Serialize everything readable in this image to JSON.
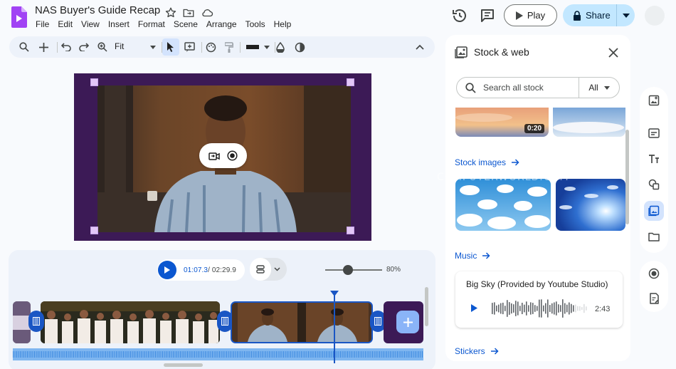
{
  "app": {
    "title": "NAS Buyer's Guide Recap"
  },
  "menu": [
    "File",
    "Edit",
    "View",
    "Insert",
    "Format",
    "Scene",
    "Arrange",
    "Tools",
    "Help"
  ],
  "header": {
    "play_label": "Play",
    "share_label": "Share"
  },
  "toolbar": {
    "zoom_value": "Fit"
  },
  "timeline": {
    "current_time": "01:07.3",
    "total_time": "/ 02:29.9",
    "zoom_percent": "80%",
    "zoom_level": 0.4
  },
  "side_panel": {
    "title": "Stock & web",
    "search_placeholder": "Search all stock",
    "filter_value": "All",
    "video_duration": "0:20",
    "section_images": "Stock images",
    "section_music": "Music",
    "section_stickers": "Stickers",
    "music": {
      "title": "Big Sky (Provided by Youtube Studio)",
      "duration": "2:43"
    }
  },
  "watermark": "COMPUTERWORLD.COM",
  "colors": {
    "accent": "#0b57d0",
    "canvas_bg": "#3c1a56",
    "share_bg": "#c2e7ff",
    "timeline_bg": "#edf2fa"
  }
}
